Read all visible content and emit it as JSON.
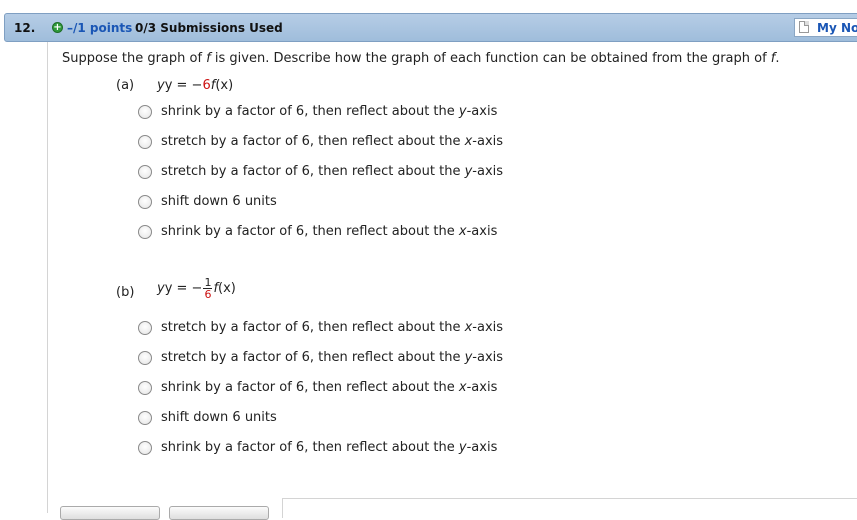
{
  "header": {
    "question_number": "12.",
    "points": "–/1 points",
    "submissions": "0/3 Submissions Used",
    "my_notes": "My Notes"
  },
  "prompt": {
    "before_f1": "Suppose the graph of ",
    "f1": "f",
    "middle": " is given. Describe how the graph of each function can be obtained from the graph of ",
    "f2": "f",
    "end": "."
  },
  "part_a": {
    "label": "(a)",
    "eq_prefix": "y = −",
    "eq_coef": "6",
    "eq_func": "f",
    "eq_arg": "(x)",
    "options": [
      "shrink by a factor of 6, then reflect about the y-axis",
      "stretch by a factor of 6, then reflect about the x-axis",
      "stretch by a factor of 6, then reflect about the y-axis",
      "shift down 6 units",
      "shrink by a factor of 6, then reflect about the x-axis"
    ]
  },
  "part_b": {
    "label": "(b)",
    "eq_prefix": "y = −",
    "frac_num": "1",
    "frac_den": "6",
    "eq_func": "f",
    "eq_arg": "(x)",
    "options": [
      "stretch by a factor of 6, then reflect about the x-axis",
      "stretch by a factor of 6, then reflect about the y-axis",
      "shrink by a factor of 6, then reflect about the x-axis",
      "shift down 6 units",
      "shrink by a factor of 6, then reflect about the y-axis"
    ]
  },
  "colors": {
    "header_bg": "#a9c6e3",
    "link_blue": "#1a56b5",
    "red": "#cc1111",
    "plus_green": "#2f9a3a"
  }
}
